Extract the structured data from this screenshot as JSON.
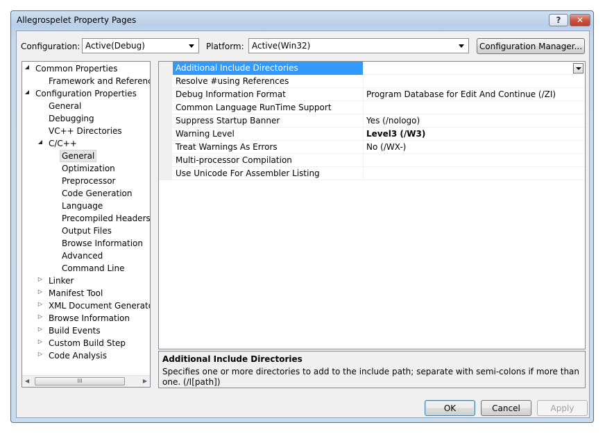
{
  "window": {
    "title": "Allegrospelet Property Pages",
    "help_label": "?",
    "close_label": "✕"
  },
  "config": {
    "configuration_label": "Configuration:",
    "configuration_value": "Active(Debug)",
    "platform_label": "Platform:",
    "platform_value": "Active(Win32)",
    "manager_button": "Configuration Manager..."
  },
  "tree": {
    "common": "Common Properties",
    "framework": "Framework and References",
    "configprops": "Configuration Properties",
    "general": "General",
    "debugging": "Debugging",
    "vcdirs": "VC++ Directories",
    "cpp": "C/C++",
    "cpp_items": [
      "General",
      "Optimization",
      "Preprocessor",
      "Code Generation",
      "Language",
      "Precompiled Headers",
      "Output Files",
      "Browse Information",
      "Advanced",
      "Command Line"
    ],
    "collapsed": [
      "Linker",
      "Manifest Tool",
      "XML Document Generator",
      "Browse Information",
      "Build Events",
      "Custom Build Step",
      "Code Analysis"
    ],
    "scroll_grip": "III"
  },
  "grid": {
    "rows": [
      {
        "name": "Additional Include Directories",
        "value": ""
      },
      {
        "name": "Resolve #using References",
        "value": ""
      },
      {
        "name": "Debug Information Format",
        "value": "Program Database for Edit And Continue (/ZI)"
      },
      {
        "name": "Common Language RunTime Support",
        "value": ""
      },
      {
        "name": "Suppress Startup Banner",
        "value": "Yes (/nologo)"
      },
      {
        "name": "Warning Level",
        "value": "Level3 (/W3)"
      },
      {
        "name": "Treat Warnings As Errors",
        "value": "No (/WX-)"
      },
      {
        "name": "Multi-processor Compilation",
        "value": ""
      },
      {
        "name": "Use Unicode For Assembler Listing",
        "value": ""
      }
    ]
  },
  "description": {
    "title": "Additional Include Directories",
    "text": "Specifies one or more directories to add to the include path; separate with semi-colons if more than one. (/I[path])"
  },
  "buttons": {
    "ok": "OK",
    "cancel": "Cancel",
    "apply": "Apply"
  }
}
